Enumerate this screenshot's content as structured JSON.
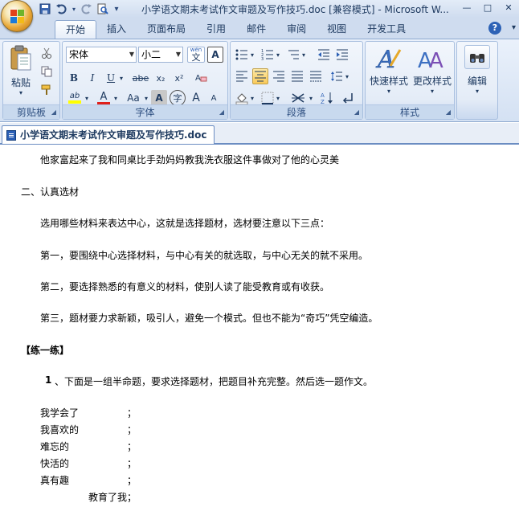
{
  "window": {
    "title": "小学语文期末考试作文审题及写作技巧.doc [兼容模式] - Microsoft W...",
    "controls": {
      "minimize": "—",
      "maximize": "□",
      "close": "✕"
    }
  },
  "quick_access": {
    "customize_arrow": "▾"
  },
  "tabs": [
    {
      "label": "开始",
      "active": true
    },
    {
      "label": "插入"
    },
    {
      "label": "页面布局"
    },
    {
      "label": "引用"
    },
    {
      "label": "邮件"
    },
    {
      "label": "审阅"
    },
    {
      "label": "视图"
    },
    {
      "label": "开发工具"
    }
  ],
  "help": "?",
  "ribbon": {
    "clipboard": {
      "label": "剪贴板",
      "paste": "粘贴"
    },
    "font": {
      "label": "字体",
      "font_name": "宋体",
      "font_size": "小二",
      "wen": "wén",
      "bold": "B",
      "italic": "I",
      "underline": "U",
      "strike": "abe",
      "subscript": "x₂",
      "superscript": "x²",
      "case": "Aa",
      "char_shade": "A",
      "enclose": "字",
      "grow": "A",
      "shrink": "A",
      "font_color": "A",
      "highlight": "ab"
    },
    "paragraph": {
      "label": "段落"
    },
    "styles": {
      "label": "样式",
      "quick_styles": "快速样式",
      "change_styles": "更改样式"
    },
    "editing": {
      "label": "编辑"
    }
  },
  "colors": {
    "accent": "#2b5fb5",
    "font_color_bar": "#e0201b",
    "highlight_bar": "#ffff00"
  },
  "document": {
    "tab_title": "小学语文期末考试作文审题及写作技巧.doc",
    "lines": [
      "他家富起来了我和同桌比手劲妈妈教我洗衣服这件事做对了他的心灵美",
      "二、认真选材",
      "选用哪些材料来表达中心，这就是选择题材，选材要注意以下三点：",
      "第一，要围绕中心选择材料，与中心有关的就选取，与中心无关的就不采用。",
      "第二，要选择熟悉的有意义的材料，使别人读了能受教育或有收获。",
      "第三，题材要力求新颖，吸引人，避免一个模式。但也不能为“奇巧”凭空编造。",
      "【练一练】",
      "1",
      "、下面是一组半命题，要求选择题材，把题目补充完整。然后选一题作文。",
      "我学会了",
      "我喜欢的",
      "难忘的",
      "快活的",
      "真有趣",
      "教育了我；"
    ],
    "semicolon": "；"
  }
}
